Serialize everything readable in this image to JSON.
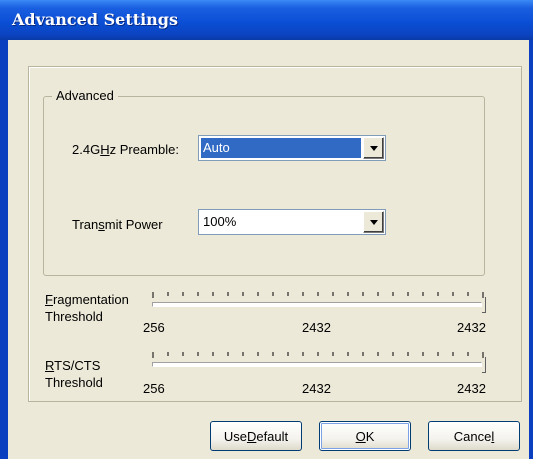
{
  "window": {
    "title": "Advanced Settings"
  },
  "group": {
    "label": "Advanced"
  },
  "preamble": {
    "label_pre": "2.4G",
    "label_mnemonic": "H",
    "label_post": "z Preamble:",
    "value": "Auto"
  },
  "power": {
    "label_pre": "Tran",
    "label_mnemonic": "s",
    "label_post": "mit Power",
    "value": "100%"
  },
  "fragmentation": {
    "label_mnemonic": "F",
    "label_rest": "ragmentation",
    "label_line2": "Threshold",
    "min": "256",
    "mid": "2432",
    "max": "2432",
    "level": 2432
  },
  "rts": {
    "label_mnemonic": "R",
    "label_rest": "TS/CTS",
    "label_line2": "Threshold",
    "min": "256",
    "mid": "2432",
    "max": "2432",
    "level": 2432
  },
  "buttons": {
    "use_default_pre": "Use ",
    "use_default_mnemonic": "D",
    "use_default_post": "efault",
    "ok_mnemonic": "O",
    "ok_post": "K",
    "cancel_pre": "Cance",
    "cancel_mnemonic": "l"
  },
  "colors": {
    "title_bar": "#0a4fd6",
    "selection": "#316ac5",
    "dialog_face": "#ece9d8"
  }
}
